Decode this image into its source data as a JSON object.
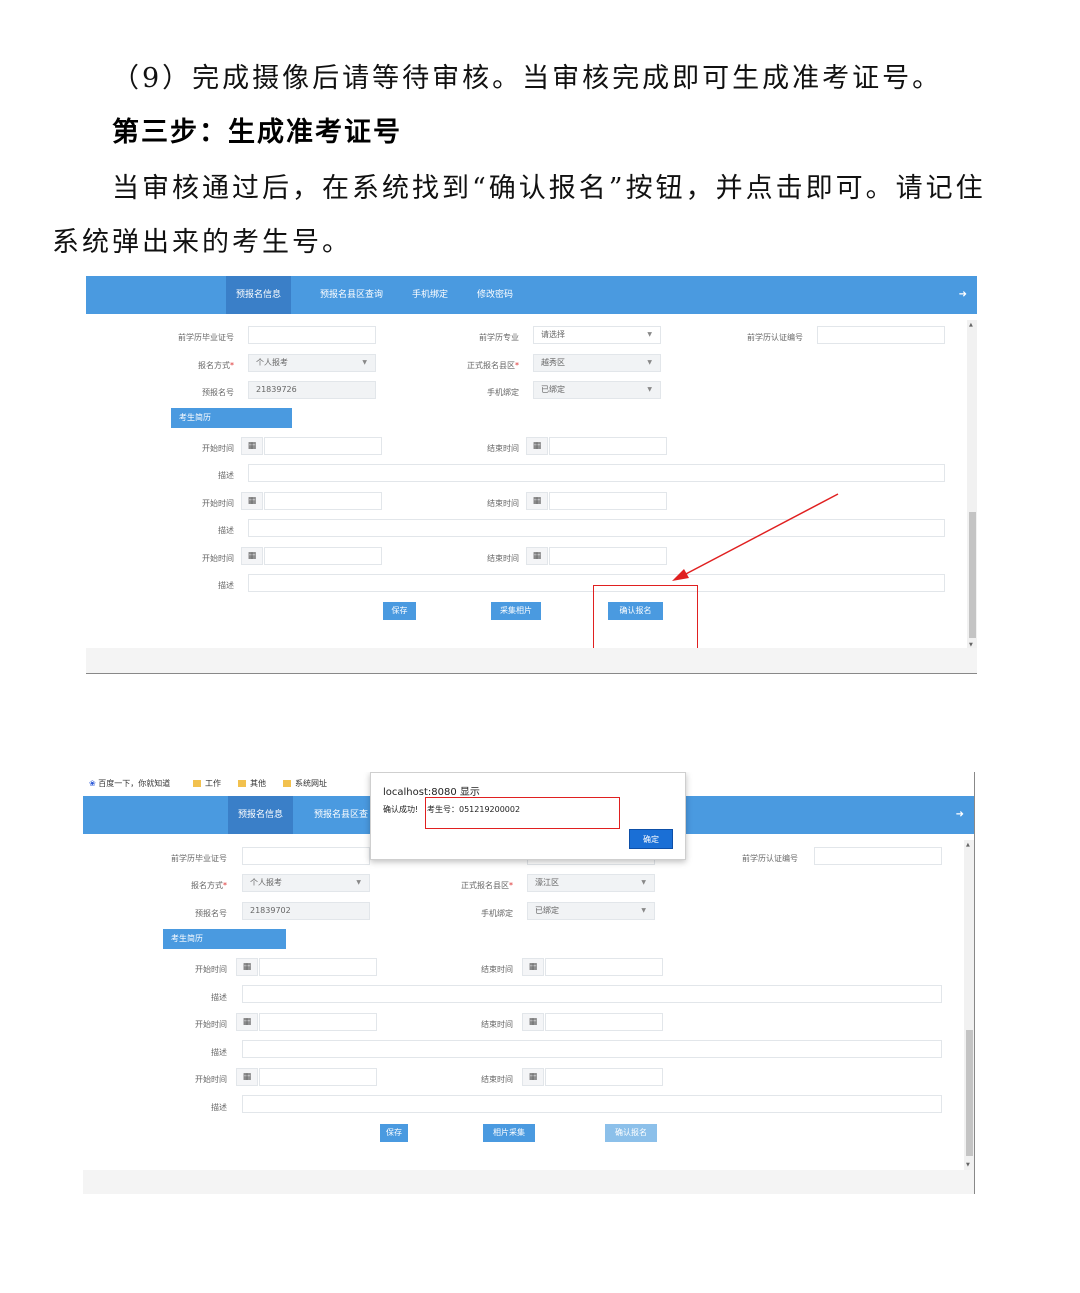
{
  "doc": {
    "step9": "（9）完成摄像后请等待审核。当审核完成即可生成准考证号。",
    "heading": "第三步：生成准考证号",
    "para_line1": "当审核通过后，在系统找到“确认报名”按钮，并点击即可。请记住",
    "para_line2": "系统弹出来的考生号。"
  },
  "nav": {
    "items": [
      "预报名信息",
      "预报名县区查询",
      "手机绑定",
      "修改密码"
    ],
    "items2": [
      "预报名信息",
      "预报名县区查"
    ],
    "logout_icon": "logout-icon"
  },
  "bookmarks": [
    "百度一下，你就知道",
    "工作",
    "其他",
    "系统网址"
  ],
  "form": {
    "grad_cert_label": "前学历毕业证号",
    "major_label": "前学历专业",
    "major_value": "请选择",
    "auth_no_label": "前学历认证编号",
    "method_label": "报名方式",
    "method_value": "个人报考",
    "district_label": "正式报名县区",
    "prereg_label": "预报名号",
    "phone_label": "手机绑定",
    "phone_value": "已绑定",
    "resume_section": "考生简历",
    "start_label": "开始时间",
    "end_label": "结束时间",
    "desc_label": "描述"
  },
  "shot1": {
    "district_value": "越秀区",
    "prereg_value": "21839726",
    "save": "保存",
    "photo": "采集相片",
    "confirm": "确认报名"
  },
  "shot2": {
    "district_value": "濠江区",
    "prereg_value": "21839702",
    "save": "保存",
    "photo": "相片采集",
    "confirm": "确认报名",
    "dialog_title": "localhost:8080 显示",
    "dialog_msg": "确认成功!",
    "dialog_number": "考生号：051219200002",
    "dialog_ok": "确定"
  }
}
